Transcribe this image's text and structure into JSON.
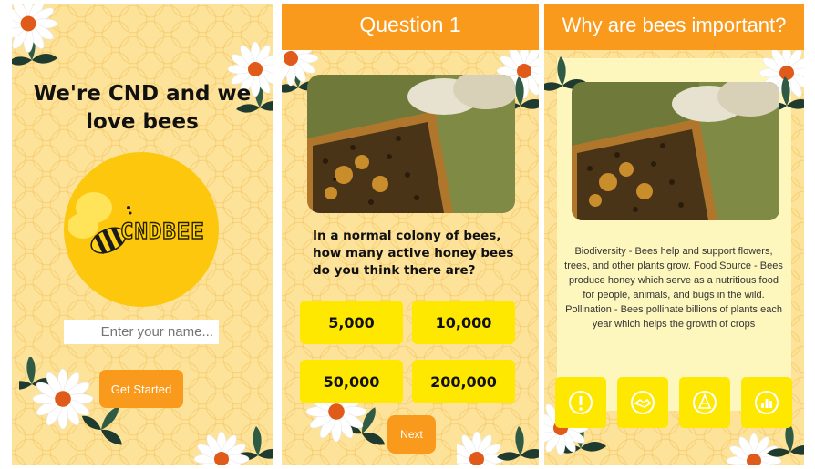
{
  "screen1": {
    "title_line1": "We're CND and we",
    "title_line2": "love bees",
    "logo_text": "CNDBEE",
    "name_placeholder": "Enter your name...",
    "start_label": "Get Started"
  },
  "screen2": {
    "header": "Question 1",
    "question": "In a normal colony of bees, how many active honey bees do you think there are?",
    "answers": [
      "5,000",
      "10,000",
      "50,000",
      "200,000"
    ],
    "next_label": "Next"
  },
  "screen3": {
    "header": "Why are bees important?",
    "info": "Biodiversity - Bees help and support flowers, trees, and other plants grow. Food Source - Bees produce honey which serve as a nutritious food for people, animals, and bugs in the wild. Pollination - Bees pollinate billions of plants each year which helps the growth of crops",
    "icons": [
      "alert-icon",
      "handshake-icon",
      "hive-icon",
      "chart-icon"
    ]
  },
  "colors": {
    "orange": "#fa9a1c",
    "yellow": "#ffe800",
    "honeycomb": "#fde29a"
  }
}
